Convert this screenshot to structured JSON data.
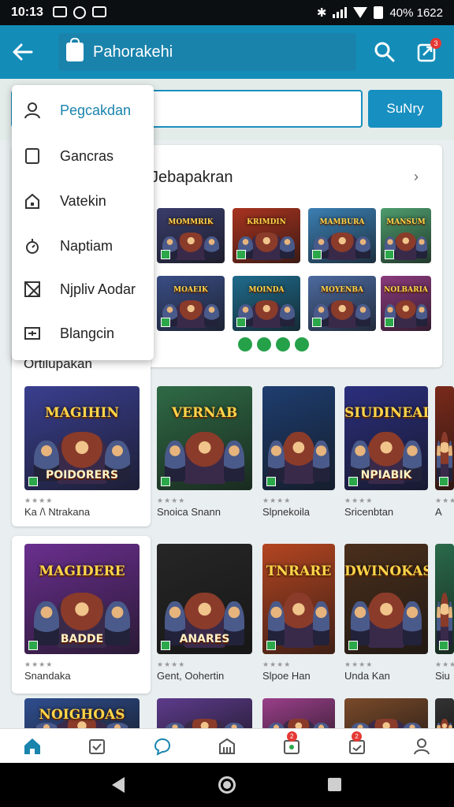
{
  "status_bar": {
    "time": "10:13",
    "battery": "40% 1622"
  },
  "app_bar": {
    "title": "Pahorakehi",
    "share_badge": "3"
  },
  "search": {
    "value": "",
    "button_label": "SuNry"
  },
  "menu": {
    "items": [
      {
        "label": "Pegcakdan",
        "icon": "person-icon"
      },
      {
        "label": "Gancras",
        "icon": "square-icon"
      },
      {
        "label": "Vatekin",
        "icon": "home-icon"
      },
      {
        "label": "Naptiam",
        "icon": "timer-icon"
      },
      {
        "label": "Njpliv Aodar",
        "icon": "image-icon"
      },
      {
        "label": "Blangcin",
        "icon": "card-icon"
      }
    ]
  },
  "section1": {
    "title": "Jebapakran",
    "tiles": [
      {
        "title": "MOMMRIK",
        "bg": "#3a3d6b"
      },
      {
        "title": "KRIMDIN",
        "bg": "#a8331f"
      },
      {
        "title": "MAMBURA",
        "bg": "#3b7fb3"
      },
      {
        "title": "MANSUM",
        "bg": "#4e9c6d"
      },
      {
        "title": "MOAEIK",
        "bg": "#3a4e86"
      },
      {
        "title": "MOINDA",
        "bg": "#1f6b8c"
      },
      {
        "title": "MOYENBA",
        "bg": "#4c6aa0"
      },
      {
        "title": "NOLBARIA",
        "bg": "#8a3a7d"
      }
    ]
  },
  "section2": {
    "title": "Ortilupakan",
    "games": [
      {
        "name": "Ka /\\ Ntrakana",
        "cover_title": "MAGIHIN",
        "cover_sub": "POIDORERS",
        "bg": "#3a3f8f"
      },
      {
        "name": "Snoica Snann",
        "cover_title": "VERNAB",
        "cover_sub": "",
        "bg": "#2f6a45"
      },
      {
        "name": "Slpnekoila",
        "cover_title": "",
        "cover_sub": "",
        "bg": "#1e3d6f"
      },
      {
        "name": "Sricenbtan",
        "cover_title": "SIUDINEAD",
        "cover_sub": "NPIABIK",
        "bg": "#2b2f7d"
      },
      {
        "name": "A",
        "cover_title": "",
        "cover_sub": "",
        "bg": "#7a2a1a"
      }
    ]
  },
  "section3": {
    "games": [
      {
        "name": "Snandaka",
        "cover_title": "MAGIDERE",
        "cover_sub": "BADDE",
        "bg": "#6a2f8f"
      },
      {
        "name": "Gent, Oohertin",
        "cover_title": "",
        "cover_sub": "ANARES",
        "bg": "#262626"
      },
      {
        "name": "Slpoe Han",
        "cover_title": "TNRARE",
        "cover_sub": "",
        "bg": "#b34521"
      },
      {
        "name": "Unda Kan",
        "cover_title": "DWINOKAS",
        "cover_sub": "",
        "bg": "#4a2f1c"
      },
      {
        "name": "Siu",
        "cover_title": "",
        "cover_sub": "",
        "bg": "#2a6a4a"
      }
    ]
  },
  "section4": {
    "games": [
      {
        "cover_title": "NOIGHOAS",
        "bg": "#2f4e8f"
      },
      {
        "cover_title": "",
        "bg": "#5d3b8c"
      },
      {
        "cover_title": "",
        "bg": "#9a3f8a"
      },
      {
        "cover_title": "",
        "bg": "#7a4a2a"
      },
      {
        "cover_title": "",
        "bg": "#333"
      }
    ]
  },
  "bottom_nav": {
    "items": [
      {
        "icon": "home-icon",
        "active": true
      },
      {
        "icon": "calendar-check-icon"
      },
      {
        "icon": "chat-icon"
      },
      {
        "icon": "building-icon"
      },
      {
        "icon": "gallery-icon",
        "badge": "2"
      },
      {
        "icon": "calendar-icon",
        "badge": "2"
      },
      {
        "icon": "profile-icon"
      }
    ]
  },
  "colors": {
    "accent": "#138db8",
    "active_nav": "#1a84ad",
    "badge": "#e53935",
    "pager_dot": "#25a14a"
  }
}
